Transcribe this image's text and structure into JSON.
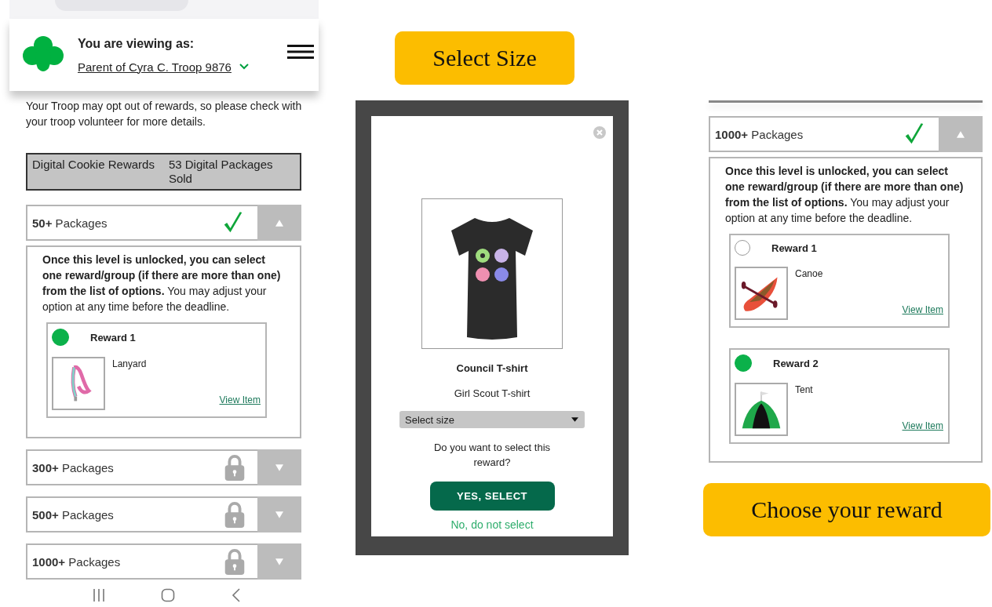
{
  "left_screen": {
    "viewing_label": "You are viewing as:",
    "viewer_link": "Parent of Cyra C. Troop 9876",
    "intro_text": "Your Troop may opt out of rewards, so please check with your troop volunteer for more details.",
    "rewards_bar": {
      "title": "Digital Cookie Rewards",
      "count": "53 Digital Packages Sold"
    },
    "levels": [
      {
        "title": "**50+** Packages",
        "unlocked": true,
        "expanded": true,
        "description": "**Once this level is unlocked, you can select one reward/group (if there are more than one) from the list of options.** You may adjust your option at any time before the deadline.",
        "rewards": [
          {
            "title": "Reward 1",
            "selected": true,
            "item": "Lanyard",
            "kind": "lanyard",
            "link": "View Item"
          }
        ]
      },
      {
        "title": "**300+** Packages",
        "unlocked": false,
        "expanded": false
      },
      {
        "title": "**500+** Packages",
        "unlocked": false,
        "expanded": false
      },
      {
        "title": "**1000+** Packages",
        "unlocked": false,
        "expanded": false
      }
    ]
  },
  "size_screen": {
    "caption": "Select Size",
    "modal": {
      "product_title": "Council T-shirt",
      "product_subtitle": "Girl Scout T-shirt",
      "size_select": {
        "placeholder": "Select size"
      },
      "question": "Do you want to select this reward?",
      "confirm_button": "YES, SELECT",
      "cancel_link": "No, do not select"
    }
  },
  "reward_screen": {
    "levels": [
      {
        "title": "**1000+** Packages",
        "unlocked": true,
        "expanded": true,
        "description": "**Once this level is unlocked, you can select one reward/group (if there are more than one) from the list of options.** You may adjust your option at any time before the deadline.",
        "rewards": [
          {
            "title": "Reward 1",
            "selected": false,
            "item": "Canoe",
            "kind": "canoe",
            "link": "View Item"
          },
          {
            "title": "Reward 2",
            "selected": true,
            "item": "Tent",
            "kind": "tent",
            "link": "View Item"
          }
        ]
      }
    ],
    "caption": "Choose your reward"
  }
}
